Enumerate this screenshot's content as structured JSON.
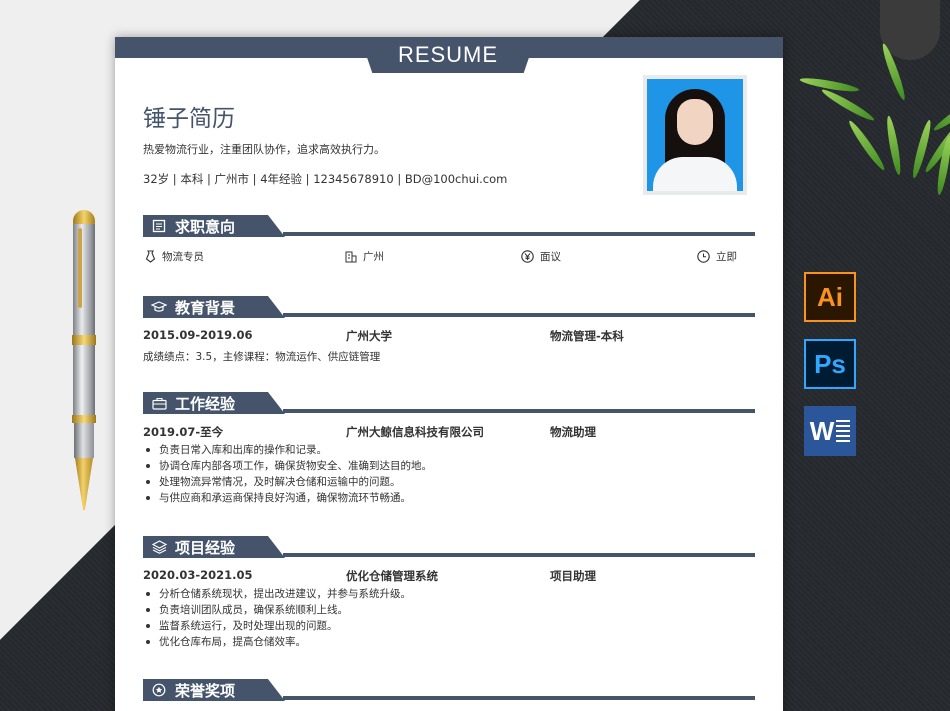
{
  "resume": {
    "tab_title": "RESUME",
    "name": "锤子简历",
    "intro": "热爱物流行业，注重团队协作，追求高效执行力。",
    "info_line": "32岁 | 本科 | 广州市 | 4年经验 | 12345678910 | BD@100chui.com"
  },
  "sections": {
    "intent": {
      "title": "求职意向",
      "items": [
        {
          "icon": "tie-icon",
          "text": "物流专员"
        },
        {
          "icon": "building-icon",
          "text": "广州"
        },
        {
          "icon": "yen-icon",
          "text": "面议"
        },
        {
          "icon": "clock-icon",
          "text": "立即"
        }
      ]
    },
    "education": {
      "title": "教育背景",
      "date": "2015.09-2019.06",
      "school": "广州大学",
      "major": "物流管理-本科",
      "detail": "成绩绩点：3.5，主修课程：物流运作、供应链管理"
    },
    "work": {
      "title": "工作经验",
      "date": "2019.07-至今",
      "company": "广州大鲸信息科技有限公司",
      "role": "物流助理",
      "bullets": [
        "负责日常入库和出库的操作和记录。",
        "协调仓库内部各项工作，确保货物安全、准确到达目的地。",
        "处理物流异常情况，及时解决仓储和运输中的问题。",
        "与供应商和承运商保持良好沟通，确保物流环节畅通。"
      ]
    },
    "project": {
      "title": "项目经验",
      "date": "2020.03-2021.05",
      "name": "优化仓储管理系统",
      "role": "项目助理",
      "bullets": [
        "分析仓储系统现状，提出改进建议，并参与系统升级。",
        "负责培训团队成员，确保系统顺利上线。",
        "监督系统运行，及时处理出现的问题。",
        "优化仓库布局，提高仓储效率。"
      ]
    },
    "awards": {
      "title": "荣誉奖项"
    }
  },
  "software_icons": [
    {
      "name": "ai-icon",
      "label": "Ai"
    },
    {
      "name": "ps-icon",
      "label": "Ps"
    },
    {
      "name": "word-icon",
      "label": "W"
    }
  ],
  "colors": {
    "accent": "#45546b",
    "photo_bg": "#1e95e6"
  }
}
